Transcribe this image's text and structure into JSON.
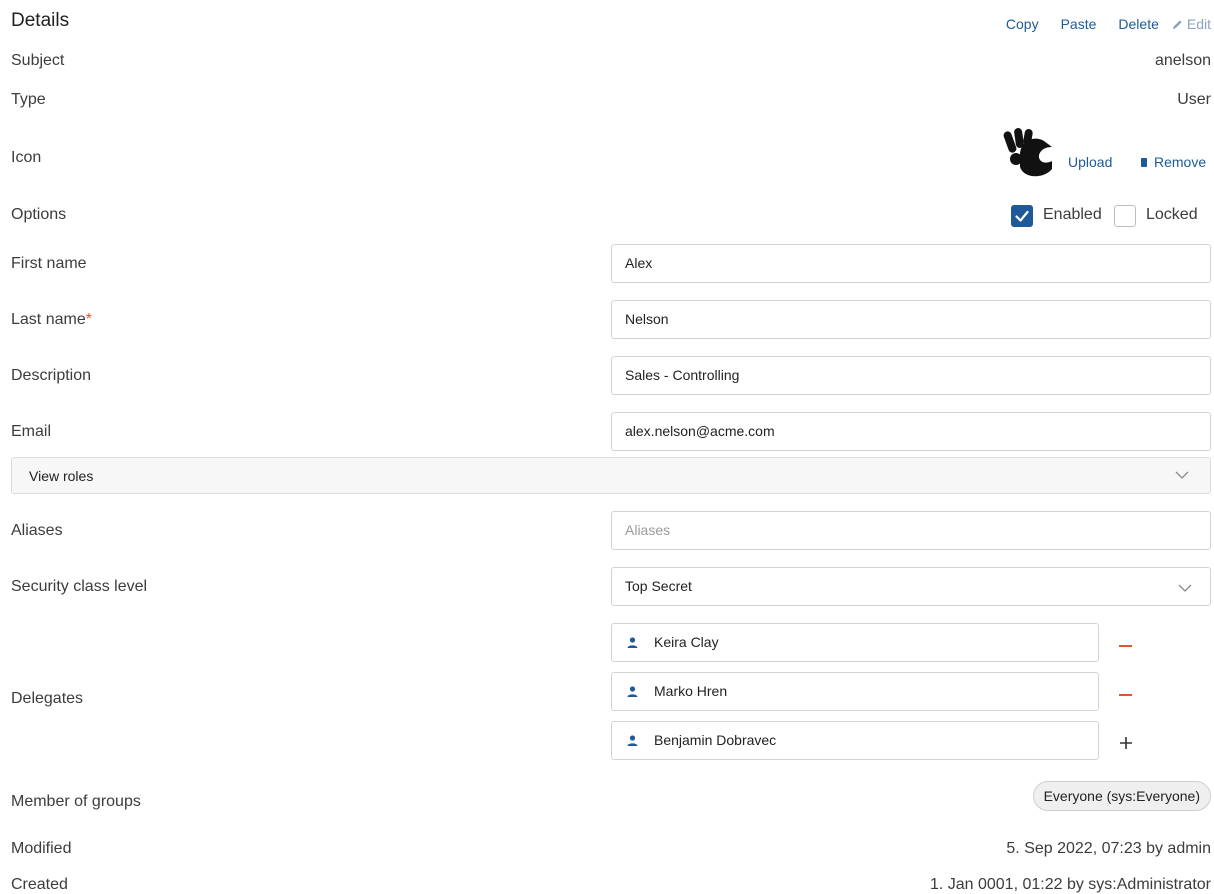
{
  "header": {
    "title": "Details",
    "actions": {
      "copy": "Copy",
      "paste": "Paste",
      "delete": "Delete",
      "edit": "Edit"
    }
  },
  "subject": {
    "label": "Subject",
    "value": "anelson"
  },
  "type": {
    "label": "Type",
    "value": "User"
  },
  "icon": {
    "label": "Icon",
    "upload": "Upload",
    "remove": "Remove"
  },
  "options": {
    "label": "Options",
    "enabled": "Enabled",
    "locked": "Locked",
    "enabled_checked": true,
    "locked_checked": false
  },
  "first_name": {
    "label": "First name",
    "value": "Alex"
  },
  "last_name": {
    "label": "Last name",
    "required_mark": "*",
    "value": "Nelson"
  },
  "description": {
    "label": "Description",
    "value": "Sales - Controlling"
  },
  "email": {
    "label": "Email",
    "value": "alex.nelson@acme.com"
  },
  "view_roles": {
    "label": "View roles"
  },
  "aliases": {
    "label": "Aliases",
    "placeholder": "Aliases"
  },
  "security": {
    "label": "Security class level",
    "value": "Top Secret"
  },
  "delegates": {
    "label": "Delegates",
    "items": [
      {
        "name": "Keira Clay",
        "action": "remove"
      },
      {
        "name": "Marko Hren",
        "action": "remove"
      },
      {
        "name": "Benjamin Dobravec",
        "action": "add"
      }
    ]
  },
  "groups": {
    "label": "Member of groups",
    "items": [
      "Everyone (sys:Everyone)"
    ]
  },
  "modified": {
    "label": "Modified",
    "value": "5. Sep 2022, 07:23 by admin"
  },
  "created": {
    "label": "Created",
    "value": "1. Jan 0001, 01:22 by sys:Administrator"
  },
  "colors": {
    "accent": "#1e5a9a",
    "remove": "#e0552e",
    "required": "#e0552e"
  }
}
